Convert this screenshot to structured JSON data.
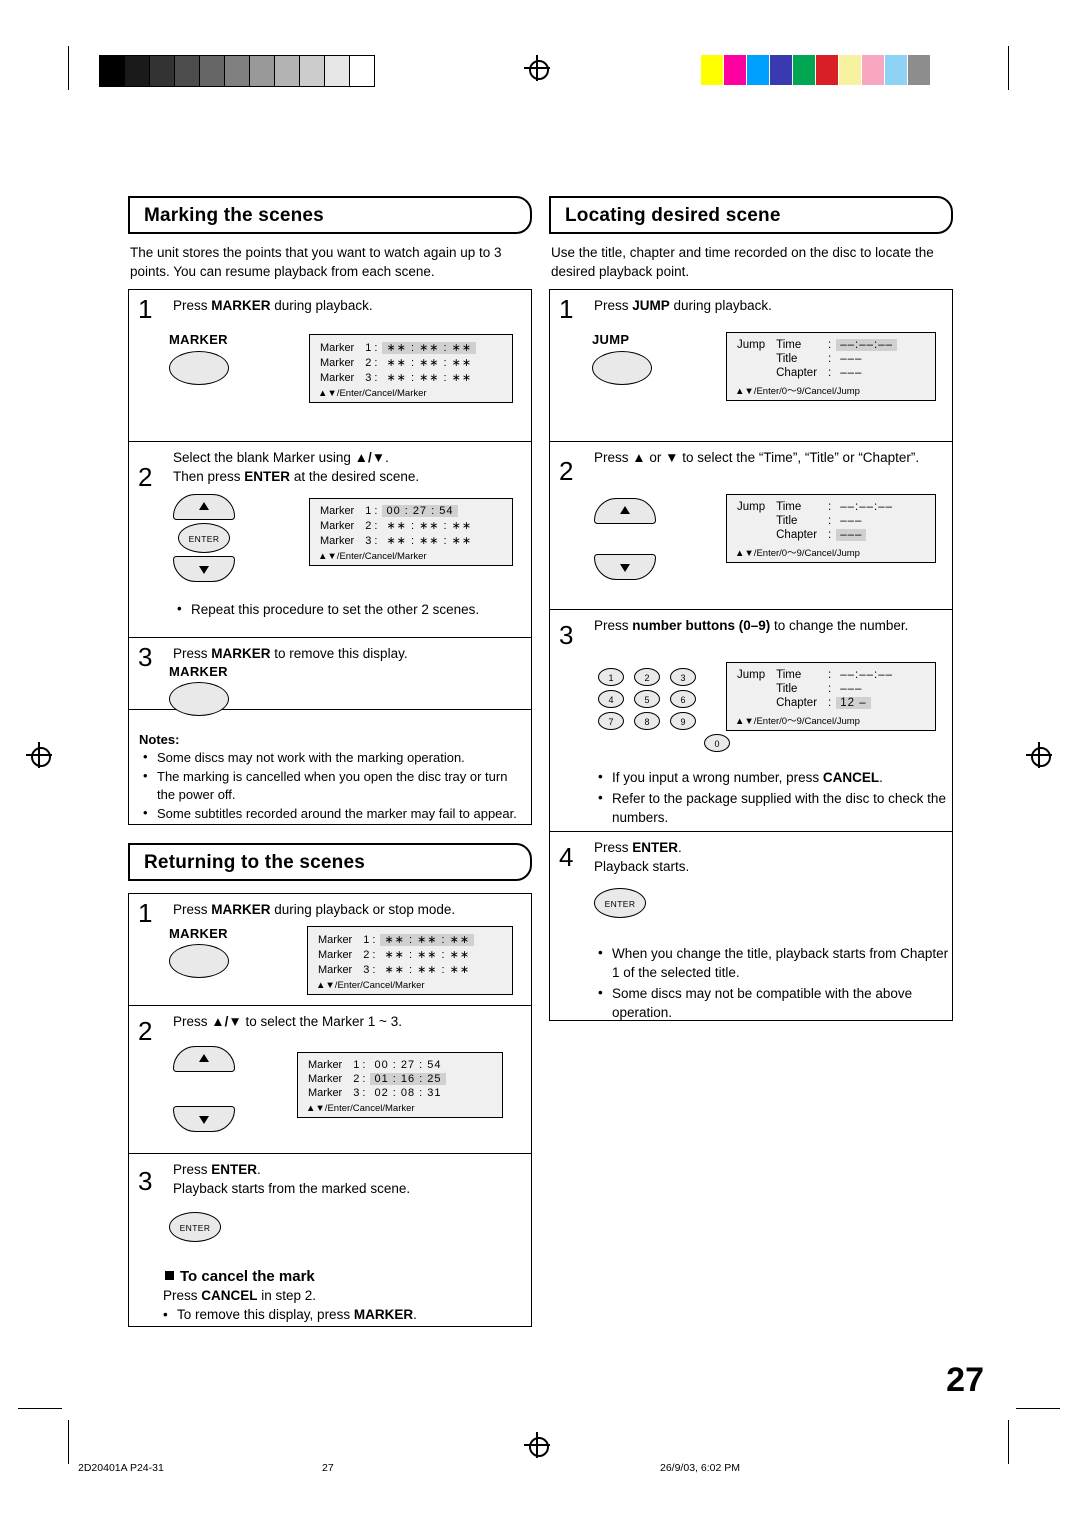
{
  "page": {
    "number": "27"
  },
  "footer": {
    "left": "2D20401A P24-31",
    "center": "27",
    "right": "26/9/03, 6:02 PM"
  },
  "sections": {
    "marking": {
      "title": "Marking the scenes",
      "intro": "The unit stores the points that you want to watch again up to 3 points. You can resume playback from each scene.",
      "step1": {
        "num": "1",
        "text_pre": "Press ",
        "text_bold": "MARKER",
        "text_post": " during playback."
      },
      "step1_button": "MARKER",
      "step1_osd": {
        "rows": [
          {
            "label": "Marker",
            "num": "1 :",
            "value": "∗∗ : ∗∗ : ∗∗",
            "highlight": true
          },
          {
            "label": "Marker",
            "num": "2 :",
            "value": "∗∗ : ∗∗ : ∗∗",
            "highlight": false
          },
          {
            "label": "Marker",
            "num": "3 :",
            "value": "∗∗ : ∗∗ : ∗∗",
            "highlight": false
          }
        ],
        "footer": "▲▼/Enter/Cancel/Marker"
      },
      "step2": {
        "num": "2",
        "line1_pre": "Select the blank Marker using ",
        "line1_post": ".",
        "line2_pre": "Then press ",
        "line2_bold": "ENTER",
        "line2_post": " at the desired scene."
      },
      "step2_osd": {
        "rows": [
          {
            "label": "Marker",
            "num": "1 :",
            "value": "00 : 27 : 54",
            "highlight": true
          },
          {
            "label": "Marker",
            "num": "2 :",
            "value": "∗∗ : ∗∗ : ∗∗",
            "highlight": false
          },
          {
            "label": "Marker",
            "num": "3 :",
            "value": "∗∗ : ∗∗ : ∗∗",
            "highlight": false
          }
        ],
        "footer": "▲▼/Enter/Cancel/Marker"
      },
      "step2_bullet": "Repeat this procedure to set the other 2 scenes.",
      "step3": {
        "num": "3",
        "text_pre": "Press ",
        "text_bold": "MARKER",
        "text_post": " to remove this display."
      },
      "step3_button": "MARKER",
      "notes_title": "Notes:",
      "notes": [
        "Some discs may not work with the  marking operation.",
        "The marking is cancelled when you open the disc tray or turn the power off.",
        "Some subtitles recorded around the marker may fail to appear."
      ]
    },
    "returning": {
      "title": "Returning to the scenes",
      "step1": {
        "num": "1",
        "text_pre": "Press ",
        "text_bold": "MARKER",
        "text_post": " during playback or stop mode."
      },
      "step1_button": "MARKER",
      "step1_osd": {
        "rows": [
          {
            "label": "Marker",
            "num": "1 :",
            "value": "∗∗ : ∗∗ : ∗∗",
            "highlight": true
          },
          {
            "label": "Marker",
            "num": "2 :",
            "value": "∗∗ : ∗∗ : ∗∗",
            "highlight": false
          },
          {
            "label": "Marker",
            "num": "3 :",
            "value": "∗∗ : ∗∗ : ∗∗",
            "highlight": false
          }
        ],
        "footer": "▲▼/Enter/Cancel/Marker"
      },
      "step2": {
        "num": "2",
        "text_pre": "Press ",
        "text_post": " to select the Marker 1 ~ 3."
      },
      "step2_osd": {
        "rows": [
          {
            "label": "Marker",
            "num": "1 :",
            "value": "00 : 27 : 54",
            "highlight": false
          },
          {
            "label": "Marker",
            "num": "2 :",
            "value": "01 : 16 : 25",
            "highlight": true
          },
          {
            "label": "Marker",
            "num": "3 :",
            "value": "02 : 08 : 31",
            "highlight": false
          }
        ],
        "footer": "▲▼/Enter/Cancel/Marker"
      },
      "step3": {
        "num": "3",
        "line1_pre": "Press ",
        "line1_bold": "ENTER",
        "line1_post": ".",
        "line2": "Playback starts from the marked scene."
      },
      "cancel_head": "To cancel the mark",
      "cancel_line1_pre": "Press ",
      "cancel_line1_bold": "CANCEL",
      "cancel_line1_post": " in step 2.",
      "cancel_bullet_pre": "To remove this display, press ",
      "cancel_bullet_bold": "MARKER",
      "cancel_bullet_post": "."
    },
    "locating": {
      "title": "Locating desired scene",
      "intro": "Use the title, chapter and time recorded on the disc to locate the desired playback point.",
      "step1": {
        "num": "1",
        "text_pre": "Press ",
        "text_bold": "JUMP",
        "text_post": " during playback."
      },
      "step1_button": "JUMP",
      "step1_osd": {
        "head": "Jump",
        "rows": [
          {
            "label": "Time",
            "colon": ":",
            "value": "––:––:––",
            "highlight": true
          },
          {
            "label": "Title",
            "colon": ":",
            "value": "–––",
            "highlight": false
          },
          {
            "label": "Chapter",
            "colon": ":",
            "value": "–––",
            "highlight": false
          }
        ],
        "footer": "▲▼/Enter/0～9/Cancel/Jump"
      },
      "step2": {
        "num": "2",
        "text_pre": "Press ",
        "text_mid": " or ",
        "text_post": " to select the “Time”, “Title” or “Chapter”."
      },
      "step2_osd": {
        "head": "Jump",
        "rows": [
          {
            "label": "Time",
            "colon": ":",
            "value": "––:––:––",
            "highlight": false
          },
          {
            "label": "Title",
            "colon": ":",
            "value": "–––",
            "highlight": false
          },
          {
            "label": "Chapter",
            "colon": ":",
            "value": "–––",
            "highlight": true
          }
        ],
        "footer": "▲▼/Enter/0～9/Cancel/Jump"
      },
      "step3": {
        "num": "3",
        "text_pre": "Press ",
        "text_bold": "number buttons (0–9)",
        "text_post": " to change the number."
      },
      "numpad": [
        "1",
        "2",
        "3",
        "4",
        "5",
        "6",
        "7",
        "8",
        "9",
        "0"
      ],
      "step3_osd": {
        "head": "Jump",
        "rows": [
          {
            "label": "Time",
            "colon": ":",
            "value": "––:––:––",
            "highlight": false
          },
          {
            "label": "Title",
            "colon": ":",
            "value": "–––",
            "highlight": false
          },
          {
            "label": "Chapter",
            "colon": ":",
            "value": "12 –",
            "highlight": true
          }
        ],
        "footer": "▲▼/Enter/0～9/Cancel/Jump"
      },
      "step3_bullets": [
        {
          "pre": "If you input a wrong number, press ",
          "bold": "CANCEL",
          "post": "."
        },
        {
          "pre": "Refer to the package supplied with the disc to check the numbers.",
          "bold": "",
          "post": ""
        }
      ],
      "step4": {
        "num": "4",
        "line1_pre": "Press ",
        "line1_bold": "ENTER",
        "line1_post": ".",
        "line2": "Playback starts."
      },
      "end_bullets": [
        "When you change the title, playback starts from Chapter 1 of the selected title.",
        "Some discs may not be compatible with the above operation."
      ]
    }
  },
  "icons": {
    "up_arrow": "▲",
    "down_arrow": "▼",
    "enter": "ENTER"
  },
  "colorbar": [
    "#ffff00",
    "#ff00a0",
    "#00a0ff",
    "#3a3ab0",
    "#00a651",
    "#d81f26",
    "#f7f2a0",
    "#f7a8c0",
    "#8fd3f4",
    "#8d8d8d"
  ],
  "greyramp": [
    "#000000",
    "#1a1a1a",
    "#333333",
    "#4d4d4d",
    "#666666",
    "#808080",
    "#999999",
    "#b3b3b3",
    "#cccccc",
    "#e6e6e6",
    "#ffffff"
  ]
}
